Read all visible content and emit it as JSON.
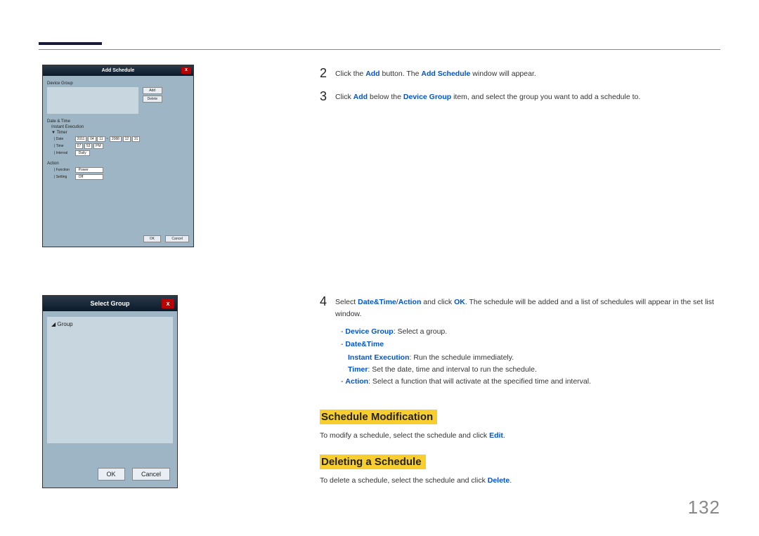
{
  "pageNumber": "132",
  "shot1": {
    "title": "Add Schedule",
    "close": "x",
    "deviceGroupLabel": "Device Group",
    "addBtn": "Add",
    "deleteBtn": "Delete",
    "dateTimeLabel": "Date & Time",
    "instantExec": "Instant Execution",
    "timerLabel": "▼ Timer",
    "dateLab": "Date",
    "dateVal1": "2011",
    "dateVal2": "04",
    "dateVal3": "11",
    "dateSep": "~",
    "dateVal4": "2088",
    "dateVal5": "12",
    "dateVal6": "31",
    "timeLab": "Time",
    "timeVal1": "07",
    "timeVal2": "53",
    "timeVal3": "PM",
    "intervalLab": "Interval",
    "intervalVal": "Daily",
    "actionLabel": "Action",
    "funcLab": "Function",
    "funcVal": "Power",
    "settingLab": "Setting",
    "settingVal": "Off",
    "ok": "OK",
    "cancel": "Cancel"
  },
  "shot2": {
    "title": "Select Group",
    "close": "x",
    "groupNode": "Group",
    "ok": "OK",
    "cancel": "Cancel"
  },
  "steps": {
    "n2": "2",
    "n3": "3",
    "n4": "4",
    "s2_a": "Click the ",
    "s2_b": "Add",
    "s2_c": " button. The ",
    "s2_d": "Add Schedule",
    "s2_e": " window will appear.",
    "s3_a": "Click ",
    "s3_b": "Add",
    "s3_c": " below the ",
    "s3_d": "Device Group",
    "s3_e": " item, and select the group you want to add a schedule to.",
    "s4_a": "Select ",
    "s4_b": "Date&Time",
    "s4_c": "/",
    "s4_d": "Action",
    "s4_e": " and click ",
    "s4_f": "OK",
    "s4_g": ". The schedule will be added and a list of schedules will appear in the set list window.",
    "sub1_a": "Device Group",
    "sub1_b": ": Select a group.",
    "sub2": "Date&Time",
    "sub2a_a": "Instant Execution",
    "sub2a_b": ": Run the schedule immediately.",
    "sub2b_a": "Timer",
    "sub2b_b": ": Set the date, time and interval to run the schedule.",
    "sub3_a": "Action",
    "sub3_b": ": Select a function that will activate at the specified time and interval."
  },
  "headings": {
    "mod": "Schedule Modification",
    "del": "Deleting a Schedule"
  },
  "modText_a": "To modify a schedule, select the schedule and click ",
  "modText_b": "Edit",
  "modText_c": ".",
  "delText_a": "To delete a schedule, select the schedule and click ",
  "delText_b": "Delete",
  "delText_c": "."
}
